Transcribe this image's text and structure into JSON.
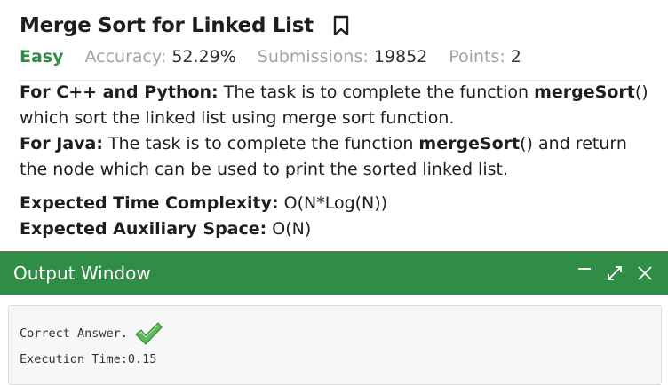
{
  "problem": {
    "title": "Merge Sort for Linked List",
    "difficulty": "Easy",
    "accuracy_label": "Accuracy:",
    "accuracy_value": "52.29%",
    "submissions_label": "Submissions:",
    "submissions_value": "19852",
    "points_label": "Points:",
    "points_value": "2"
  },
  "description": {
    "cpp_python_label": "For C++ and Python:",
    "cpp_python_text_1": " The task is to complete the function ",
    "cpp_python_func": "mergeSort",
    "cpp_python_parens": "()",
    "cpp_python_text_2": " which sort the linked list using merge sort function.",
    "java_label": "For Java:",
    "java_text_1": " The task is to complete the function ",
    "java_func": "mergeSort",
    "java_parens": "()",
    "java_text_2": " and return the node which can be used to print the sorted linked list.",
    "time_label": "Expected Time Complexity:",
    "time_value": " O(N*Log(N))",
    "space_label": "Expected Auxiliary Space:",
    "space_value": " O(N)"
  },
  "output_window": {
    "title": "Output Window",
    "result_text": "Correct Answer.",
    "execution_time": "Execution Time:0.15"
  },
  "icons": {
    "bookmark": "bookmark-icon",
    "minimize": "minimize-icon",
    "expand": "expand-icon",
    "close": "close-icon",
    "check": "checkmark-icon"
  },
  "colors": {
    "accent_green": "#2f8d46",
    "muted_gray": "#a0a3a8"
  }
}
